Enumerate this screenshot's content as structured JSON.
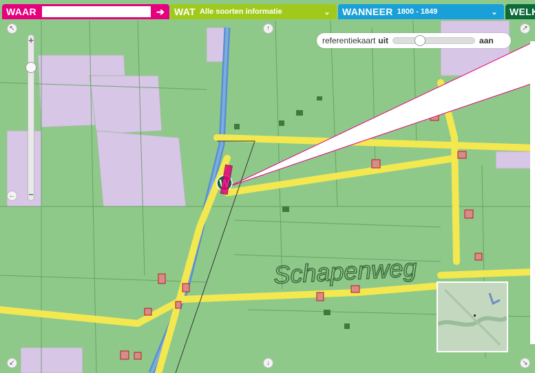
{
  "nav": {
    "waar_label": "WAAR",
    "waar_input_value": "",
    "wat_label": "WAT",
    "wat_value": "Alle soorten informatie",
    "wanneer_label": "WANNEER",
    "wanneer_value": "1800 - 1849",
    "welk_label": "WELK",
    "go_icon": "arrow-right-icon",
    "dropdown_icon": "chevron-down-icon"
  },
  "reference_map": {
    "label": "referentiekaart",
    "off_label": "uit",
    "on_label": "aan",
    "level": 0.3
  },
  "map": {
    "street_label": "Schapenweg",
    "marker_label": "W"
  },
  "colors": {
    "waar": "#e6007e",
    "wat": "#9fca1c",
    "wanneer": "#1aa0d8",
    "welk": "#0d6b3a",
    "map_green": "#8fc98a",
    "road_yellow": "#f3e850",
    "water_blue": "#5b8fcf"
  }
}
